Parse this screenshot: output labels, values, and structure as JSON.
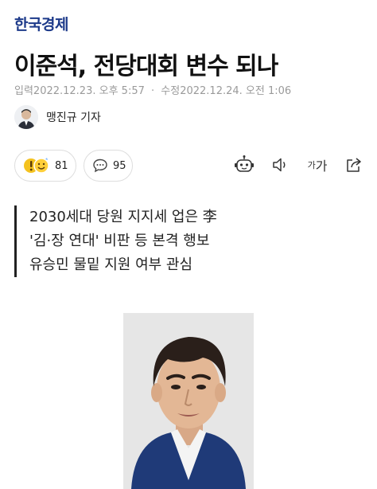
{
  "brand": {
    "name": "한국경제"
  },
  "article": {
    "headline": "이준석, 전당대회 변수 되나",
    "input_date": "입력2022.12.23. 오후 5:57",
    "separator": "·",
    "modified_date": "수정2022.12.24. 오전 1:06",
    "author": "맹진규 기자",
    "summary_lines": [
      "2030세대 당원 지지세 업은 李",
      "'김·장 연대' 비판 등 본격 행보",
      "유승민 물밑 지원 여부 관심"
    ]
  },
  "toolbar": {
    "reaction_count": "81",
    "comment_count": "95",
    "font_label_small": "가",
    "font_label_large": "가"
  },
  "icons": {
    "reaction": "reaction-emoji-icon",
    "comment": "speech-bubble-icon",
    "summary": "robot-icon",
    "audio": "speaker-icon",
    "share": "share-icon"
  },
  "colors": {
    "brand": "#1d3a8a",
    "suit": "#1f3a78"
  }
}
